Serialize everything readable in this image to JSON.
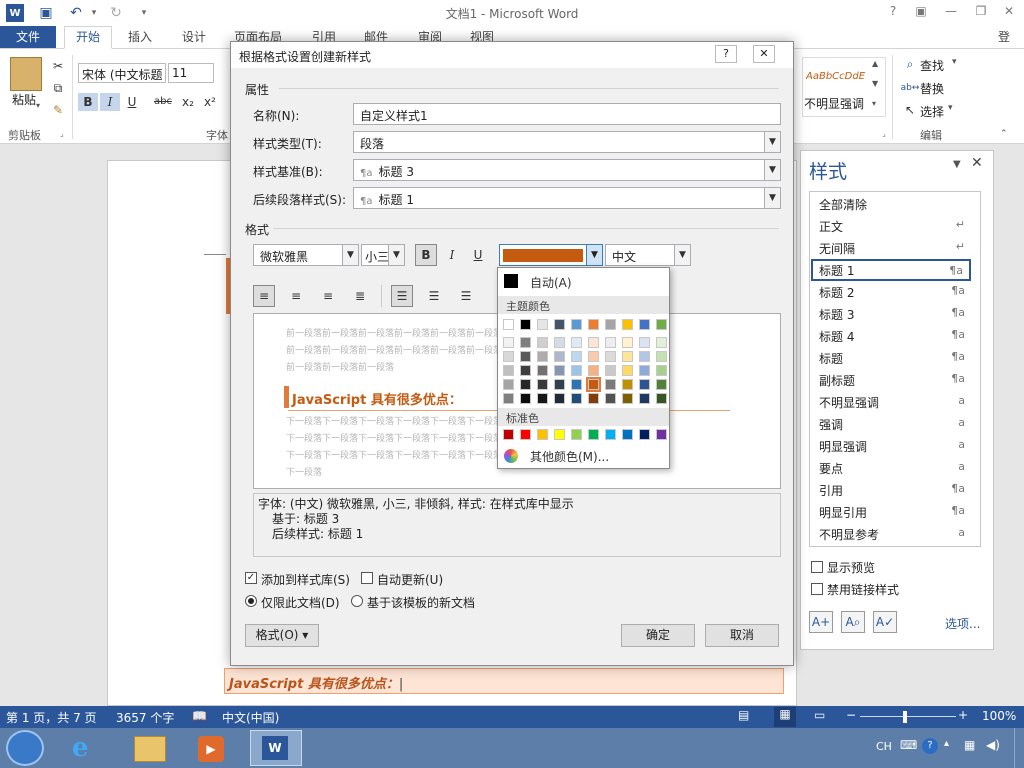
{
  "titlebar": {
    "title": "文档1 - Microsoft Word",
    "help": "?",
    "icons": [
      "word-icon",
      "save-icon",
      "undo-icon",
      "redo-icon"
    ]
  },
  "tabs": {
    "file": "文件",
    "home": "开始",
    "items": [
      "插入",
      "设计",
      "页面布局",
      "引用",
      "邮件",
      "审阅",
      "视图"
    ],
    "login": "登录"
  },
  "ribbon": {
    "paste": "粘贴",
    "clipboard": "剪贴板",
    "font_label": "字体",
    "font_name": "宋体 (中文标题",
    "font_size": "11",
    "bold": "B",
    "italic": "I",
    "underline": "U",
    "strike": "abc",
    "sub": "x₂",
    "sup": "x²",
    "style_preview": "AaBbCcDdE",
    "style_name": "不明显强调",
    "find": "查找",
    "replace": "替换",
    "select": "选择",
    "edit": "编辑"
  },
  "dialog": {
    "title": "根据格式设置创建新样式",
    "help": "?",
    "close": "✕",
    "props_label": "属性",
    "name_label": "名称(N):",
    "name_value": "自定义样式1",
    "type_label": "样式类型(T):",
    "type_value": "段落",
    "based_label": "样式基准(B):",
    "based_value": "标题 3",
    "next_label": "后续段落样式(S):",
    "next_value": "标题 1",
    "format_label": "格式",
    "font": "微软雅黑",
    "size": "小三",
    "bold": "B",
    "italic": "I",
    "underline": "U",
    "lang": "中文",
    "color_hex": "#c55a11",
    "prev_text": "前一段落前一段落前一段落前一段落前一段落前一段落前一段落前一段落前一段落前一段落",
    "prev_text_short": "前一段落前一段落前一段落",
    "sample": "JavaScript 具有很多优点：",
    "next_text": "下一段落下一段落下一段落下一段落下一段落下一段落下一段落下一段落下一段落下一段落",
    "next_text_short": "下一段落",
    "desc_line1": "字体: (中文) 微软雅黑, 小三, 非倾斜, 样式: 在样式库中显示",
    "desc_line2": "基于: 标题 3",
    "desc_line3": "后续样式: 标题 1",
    "add_gallery": "添加到样式库(S)",
    "auto_update": "自动更新(U)",
    "only_doc": "仅限此文档(D)",
    "new_template": "基于该模板的新文档",
    "format_btn": "格式(O) ▾",
    "ok": "确定",
    "cancel": "取消",
    "style_mark": "¶a"
  },
  "colorpop": {
    "auto": "自动(A)",
    "theme_label": "主题颜色",
    "standard_label": "标准色",
    "more": "其他颜色(M)...",
    "theme_top": [
      "#ffffff",
      "#000000",
      "#e7e6e6",
      "#44546a",
      "#5b9bd5",
      "#ed7d31",
      "#a5a5a5",
      "#ffc000",
      "#4472c4",
      "#70ad47"
    ],
    "theme_shades": [
      [
        "#f2f2f2",
        "#7f7f7f",
        "#d0cece",
        "#d6dce4",
        "#deebf6",
        "#fbe5d5",
        "#ededed",
        "#fff2cc",
        "#dae3f3",
        "#e2efd9"
      ],
      [
        "#d8d8d8",
        "#595959",
        "#aeabab",
        "#adb9ca",
        "#bdd7ee",
        "#f7cbac",
        "#dbdbdb",
        "#fee599",
        "#b4c6e7",
        "#c5e0b3"
      ],
      [
        "#bfbfbf",
        "#3f3f3f",
        "#757070",
        "#8496b0",
        "#9dc3e6",
        "#f4b183",
        "#c9c9c9",
        "#ffd965",
        "#8eaadb",
        "#a8d08d"
      ],
      [
        "#a5a5a5",
        "#262626",
        "#3a3838",
        "#323f4f",
        "#2e75b5",
        "#c55a11",
        "#7b7b7b",
        "#bf9000",
        "#2f5496",
        "#538135"
      ],
      [
        "#7f7f7f",
        "#0c0c0c",
        "#171616",
        "#222a35",
        "#1e4e79",
        "#833c0b",
        "#525252",
        "#7f6000",
        "#1f3864",
        "#375623"
      ]
    ],
    "standard": [
      "#c00000",
      "#ff0000",
      "#ffc000",
      "#ffff00",
      "#92d050",
      "#00b050",
      "#00b0f0",
      "#0070c0",
      "#002060",
      "#7030a0"
    ]
  },
  "styles_pane": {
    "title": "样式",
    "items": [
      {
        "label": "全部清除",
        "mark": ""
      },
      {
        "label": "正文",
        "mark": "↵"
      },
      {
        "label": "无间隔",
        "mark": "↵"
      },
      {
        "label": "标题 1",
        "mark": "¶a"
      },
      {
        "label": "标题 2",
        "mark": "¶a"
      },
      {
        "label": "标题 3",
        "mark": "¶a"
      },
      {
        "label": "标题 4",
        "mark": "¶a"
      },
      {
        "label": "标题",
        "mark": "¶a"
      },
      {
        "label": "副标题",
        "mark": "¶a"
      },
      {
        "label": "不明显强调",
        "mark": "a"
      },
      {
        "label": "强调",
        "mark": "a"
      },
      {
        "label": "明显强调",
        "mark": "a"
      },
      {
        "label": "要点",
        "mark": "a"
      },
      {
        "label": "引用",
        "mark": "¶a"
      },
      {
        "label": "明显引用",
        "mark": "¶a"
      },
      {
        "label": "不明显参考",
        "mark": "a"
      }
    ],
    "show_preview": "显示预览",
    "disable_linked": "禁用链接样式",
    "options": "选项..."
  },
  "document": {
    "line": "JavaScript 具有很多优点："
  },
  "statusbar": {
    "page": "第 1 页，共 7 页",
    "words": "3657 个字",
    "lang": "中文(中国)",
    "zoom": "100%"
  },
  "taskbar": {
    "tray_lang": "CH"
  }
}
